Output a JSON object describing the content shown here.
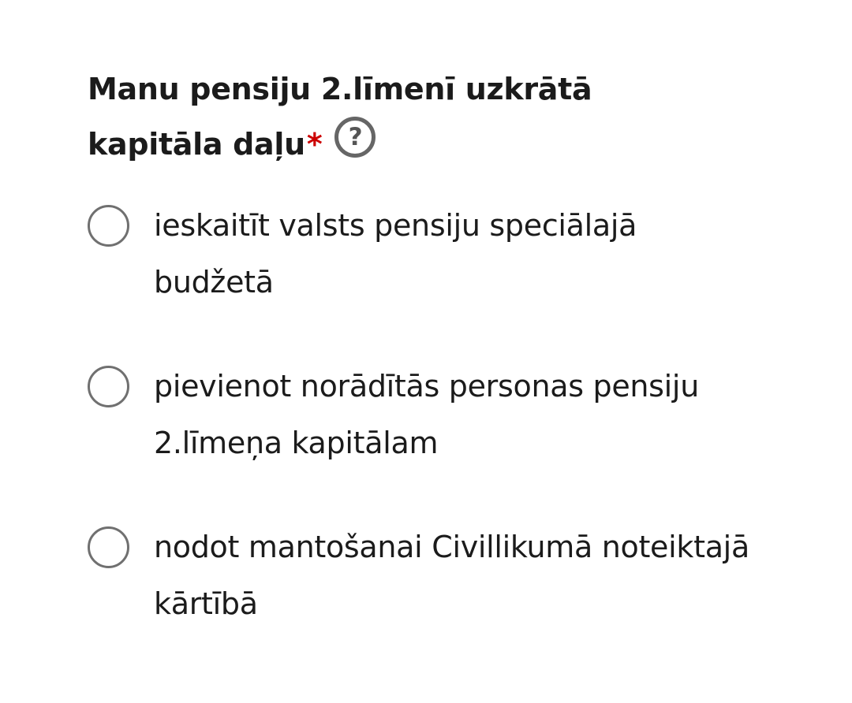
{
  "question": {
    "text": "Manu pensiju 2.līmenī uzkrātā kapitāla daļu",
    "required_marker": "*",
    "help_glyph": "?"
  },
  "options": [
    {
      "label": "ieskaitīt valsts pensiju speciālajā budžetā",
      "selected": false
    },
    {
      "label": "pievienot norādītās personas pensiju 2.līmeņa kapitālam",
      "selected": false
    },
    {
      "label": "nodot mantošanai Civillikumā noteiktajā kārtībā",
      "selected": false
    }
  ],
  "colors": {
    "text": "#1b1b1b",
    "required": "#cc0000",
    "radio_border": "#707070",
    "help_icon": "#666666"
  },
  "icons": {
    "help": "question-circle-icon"
  }
}
